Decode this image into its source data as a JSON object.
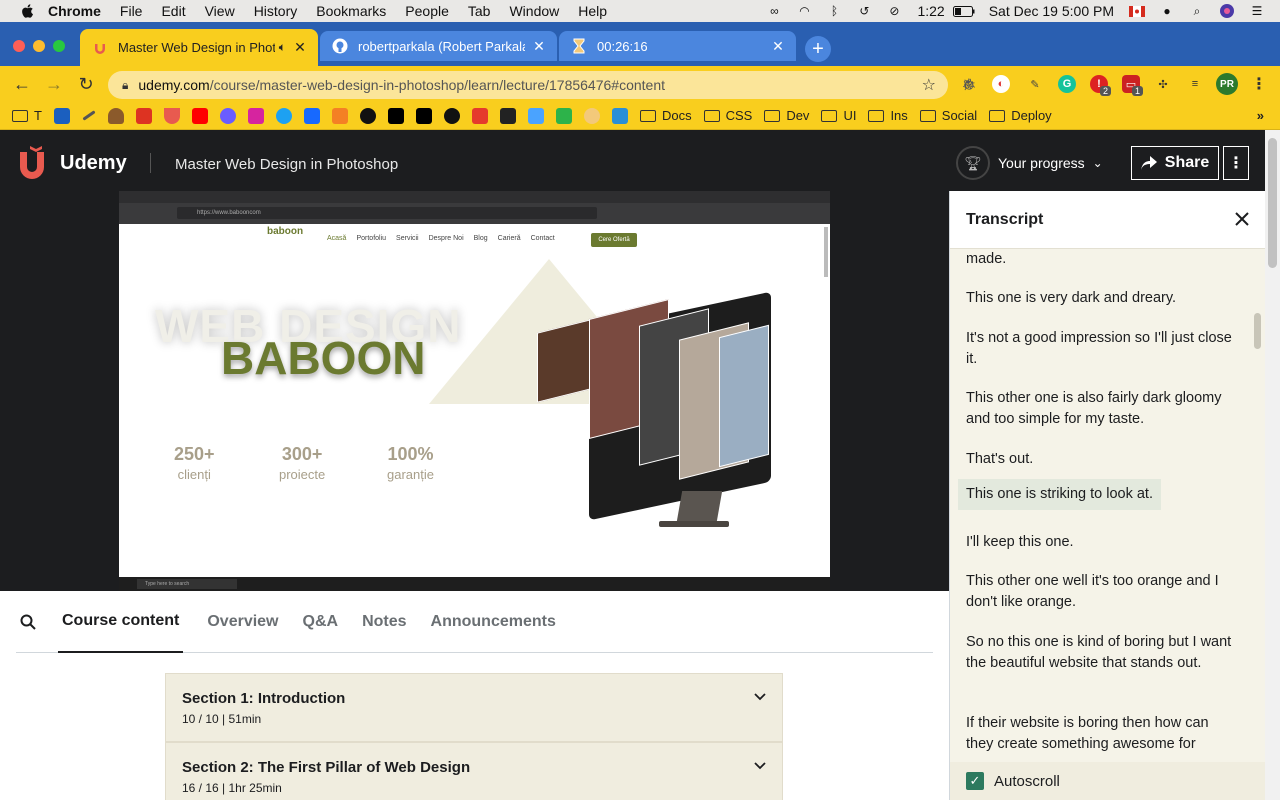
{
  "menubar": {
    "app": "Chrome",
    "items": [
      "File",
      "Edit",
      "View",
      "History",
      "Bookmarks",
      "People",
      "Tab",
      "Window",
      "Help"
    ],
    "time_short": "1:22",
    "datetime": "Sat Dec 19  5:00 PM"
  },
  "tabs": [
    {
      "label": "Master Web Design in Phot",
      "active": true,
      "favicon": "udemy-icon"
    },
    {
      "label": "robertparkala (Robert Parkala)",
      "active": false,
      "favicon": "github-icon"
    },
    {
      "label": "00:26:16",
      "active": false,
      "favicon": "timer-icon"
    }
  ],
  "tab_close_glyph": "✕",
  "address": {
    "host": "udemy.com",
    "path": "/course/master-web-design-in-photoshop/learn/lecture/17856476#content"
  },
  "extension_badges": {
    "first": "2",
    "second": "1",
    "avatar": "PR"
  },
  "bookmarks": {
    "first_label": "T",
    "folders": [
      "Docs",
      "CSS",
      "Dev",
      "UI",
      "Ins",
      "Social",
      "Deploy"
    ],
    "overflow": "»"
  },
  "udemy": {
    "brand": "Udemy",
    "course_title": "Master Web Design in Photoshop",
    "progress_label": "Your progress",
    "share_label": "Share"
  },
  "video": {
    "address": "https://www.babooncom",
    "nav": [
      "Acasă",
      "Portofoliu",
      "Servicii",
      "Despre Noi",
      "Blog",
      "Carieră",
      "Contact"
    ],
    "logo": "baboon",
    "cta": "Cere Ofertă",
    "hero_top": "WEB DESIGN",
    "hero_bottom": "BABOON",
    "stats": [
      {
        "num": "250+",
        "label": "clienți"
      },
      {
        "num": "300+",
        "label": "proiecte"
      },
      {
        "num": "100%",
        "label": "garanție"
      }
    ],
    "taskbar_search": "Type here to search"
  },
  "lower_tabs": [
    "Course content",
    "Overview",
    "Q&A",
    "Notes",
    "Announcements"
  ],
  "sections": [
    {
      "title": "Section 1: Introduction",
      "meta": "10 / 10 | 51min"
    },
    {
      "title": "Section 2: The First Pillar of Web Design",
      "meta": "16 / 16 | 1hr 25min"
    }
  ],
  "transcript": {
    "title": "Transcript",
    "cues": [
      "made.",
      "This one is very dark and dreary.",
      "It's not a good impression so I'll just close it.",
      "This other one is also fairly dark gloomy and too simple for my taste.",
      "That's out.",
      "This one is striking to look at.",
      "I'll keep this one.",
      "This other one well it's too orange and I don't like orange.",
      "So no this one is kind of boring but I want the beautiful website that stands out.",
      "If their website is boring then how can they create something awesome for"
    ],
    "highlighted_index": 5,
    "autoscroll_label": "Autoscroll",
    "autoscroll_checked": true
  },
  "colors": {
    "udemy_header": "#1c1d1f",
    "tab_active": "#f9ce1e",
    "tabstrip": "#2a5fb1",
    "accent_olive": "#6b7a30",
    "highlight": "#e3e9dd"
  }
}
